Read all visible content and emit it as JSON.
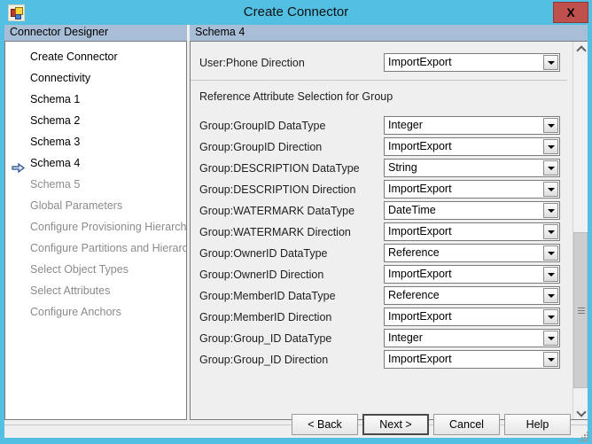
{
  "window": {
    "title": "Create Connector",
    "app_icon": "connector-app-icon",
    "close_label": "X"
  },
  "left_panel": {
    "caption": "Connector Designer",
    "items": [
      {
        "label": "Create Connector",
        "state": "enabled",
        "current": false
      },
      {
        "label": "Connectivity",
        "state": "enabled",
        "current": false
      },
      {
        "label": "Schema 1",
        "state": "enabled",
        "current": false
      },
      {
        "label": "Schema 2",
        "state": "enabled",
        "current": false
      },
      {
        "label": "Schema 3",
        "state": "enabled",
        "current": false
      },
      {
        "label": "Schema 4",
        "state": "enabled",
        "current": true
      },
      {
        "label": "Schema 5",
        "state": "disabled",
        "current": false
      },
      {
        "label": "Global Parameters",
        "state": "disabled",
        "current": false
      },
      {
        "label": "Configure Provisioning Hierarchy",
        "state": "disabled",
        "current": false
      },
      {
        "label": "Configure Partitions and Hierarchies",
        "state": "disabled",
        "current": false
      },
      {
        "label": "Select Object Types",
        "state": "disabled",
        "current": false
      },
      {
        "label": "Select Attributes",
        "state": "disabled",
        "current": false
      },
      {
        "label": "Configure Anchors",
        "state": "disabled",
        "current": false
      }
    ]
  },
  "right_panel": {
    "caption": "Schema 4",
    "top_row": {
      "label": "User:Phone Direction",
      "value": "ImportExport"
    },
    "section_title": "Reference Attribute Selection for Group",
    "rows": [
      {
        "label": "Group:GroupID DataType",
        "value": "Integer"
      },
      {
        "label": "Group:GroupID Direction",
        "value": "ImportExport"
      },
      {
        "label": "Group:DESCRIPTION DataType",
        "value": "String"
      },
      {
        "label": "Group:DESCRIPTION Direction",
        "value": "ImportExport"
      },
      {
        "label": "Group:WATERMARK DataType",
        "value": "DateTime"
      },
      {
        "label": "Group:WATERMARK Direction",
        "value": "ImportExport"
      },
      {
        "label": "Group:OwnerID DataType",
        "value": "Reference"
      },
      {
        "label": "Group:OwnerID Direction",
        "value": "ImportExport"
      },
      {
        "label": "Group:MemberID DataType",
        "value": "Reference"
      },
      {
        "label": "Group:MemberID Direction",
        "value": "ImportExport"
      },
      {
        "label": "Group:Group_ID DataType",
        "value": "Integer"
      },
      {
        "label": "Group:Group_ID Direction",
        "value": "ImportExport"
      }
    ],
    "scrollbar": {
      "up_icon": "chevron-up-icon",
      "down_icon": "chevron-down-icon"
    }
  },
  "buttons": {
    "back": "< Back",
    "next": "Next  >",
    "cancel": "Cancel",
    "help": "Help"
  },
  "colors": {
    "window_frame": "#52bfe3",
    "caption_band": "#a8bed6",
    "close_button": "#c0504d",
    "panel_face": "#efefef",
    "current_arrow": "#2a4a8f"
  }
}
